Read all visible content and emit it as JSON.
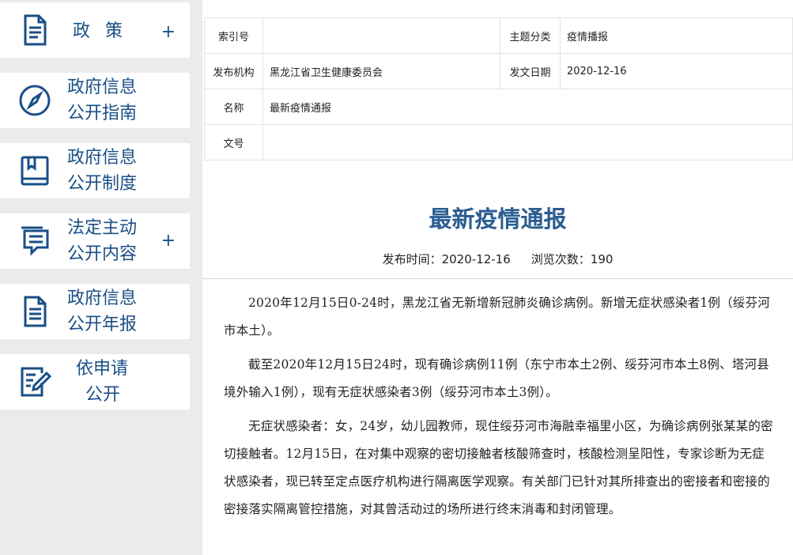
{
  "sidebar": {
    "items": [
      {
        "label": "政 策",
        "plus": "+",
        "icon": "document-icon"
      },
      {
        "label_line1": "政府信息",
        "label_line2": "公开指南",
        "icon": "compass-icon"
      },
      {
        "label_line1": "政府信息",
        "label_line2": "公开制度",
        "icon": "book-icon"
      },
      {
        "label_line1": "法定主动",
        "label_line2": "公开内容",
        "plus": "+",
        "icon": "message-list-icon"
      },
      {
        "label_line1": "政府信息",
        "label_line2": "公开年报",
        "icon": "report-icon"
      },
      {
        "label_line1": "依申请",
        "label_line2": "公开",
        "icon": "edit-form-icon"
      }
    ]
  },
  "info_table": {
    "index_label": "索引号",
    "index_value": "",
    "category_label": "主题分类",
    "category_value": "疫情播报",
    "publisher_label": "发布机构",
    "publisher_value": "黑龙江省卫生健康委员会",
    "date_label": "发文日期",
    "date_value": "2020-12-16",
    "name_label": "名称",
    "name_value": "最新疫情通报",
    "docno_label": "文号",
    "docno_value": ""
  },
  "article": {
    "title": "最新疫情通报",
    "publish_label": "发布时间：",
    "publish_date": "2020-12-16",
    "views_label": "浏览次数：",
    "views": "190",
    "paragraphs": [
      "2020年12月15日0-24时，黑龙江省无新增新冠肺炎确诊病例。新增无症状感染者1例（绥芬河市本土）。",
      "截至2020年12月15日24时，现有确诊病例11例（东宁市本土2例、绥芬河市本土8例、塔河县境外输入1例），现有无症状感染者3例（绥芬河市本土3例）。",
      "无症状感染者：女，24岁，幼儿园教师，现住绥芬河市海融幸福里小区，为确诊病例张某某的密切接触者。12月15日，在对集中观察的密切接触者核酸筛查时，核酸检测呈阳性，专家诊断为无症状感染者，现已转至定点医疗机构进行隔离医学观察。有关部门已针对其所排查出的密接者和密接的密接落实隔离管控措施，对其曾活动过的场所进行终末消毒和封闭管理。"
    ]
  },
  "colors": {
    "accent": "#1a4f86",
    "title": "#2b5d91",
    "sidebar_bg": "#ebebeb"
  }
}
